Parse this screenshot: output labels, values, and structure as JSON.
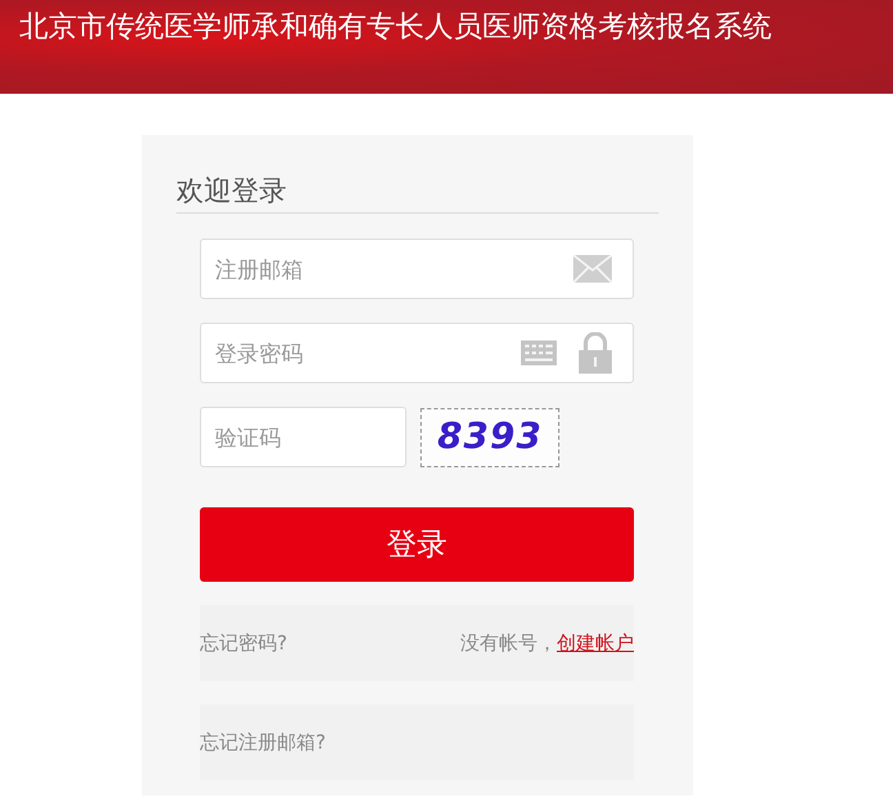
{
  "header": {
    "title": "北京市传统医学师承和确有专长人员医师资格考核报名系统"
  },
  "login": {
    "heading": "欢迎登录",
    "email_field": {
      "placeholder": "注册邮箱"
    },
    "password_field": {
      "placeholder": "登录密码"
    },
    "captcha_field": {
      "placeholder": "验证码"
    },
    "captcha_code": "8393",
    "submit_button": "登录",
    "forgot_password": "忘记密码?",
    "no_account": "没有帐号，",
    "create_account": "创建帐户",
    "forgot_email": "忘记注册邮箱?"
  }
}
